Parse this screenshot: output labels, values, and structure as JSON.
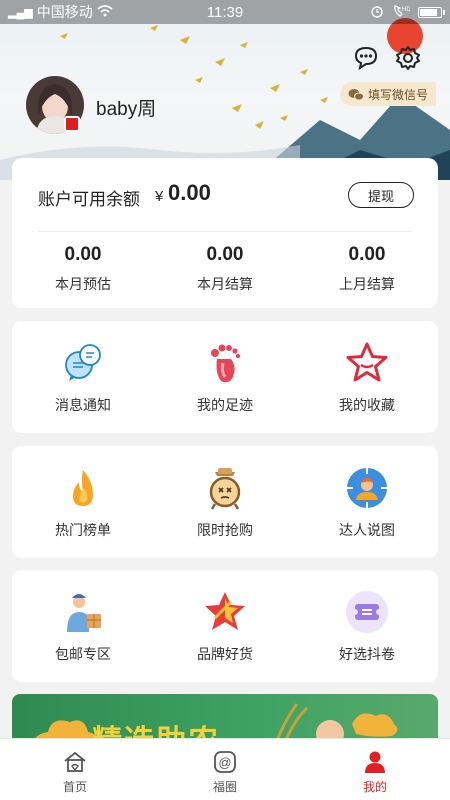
{
  "status_bar": {
    "carrier": "中国移动",
    "time": "11:39",
    "battery_level": 0.9
  },
  "profile": {
    "username": "baby周",
    "wechat_button": "填写微信号"
  },
  "balance": {
    "label": "账户可用余额",
    "currency": "¥",
    "amount": "0.00",
    "withdraw_button": "提现",
    "stats": [
      {
        "value": "0.00",
        "label": "本月预估"
      },
      {
        "value": "0.00",
        "label": "本月结算"
      },
      {
        "value": "0.00",
        "label": "上月结算"
      }
    ]
  },
  "menu_rows": [
    [
      {
        "label": "消息通知",
        "icon": "message-notification-icon"
      },
      {
        "label": "我的足迹",
        "icon": "footprint-icon"
      },
      {
        "label": "我的收藏",
        "icon": "star-icon"
      }
    ],
    [
      {
        "label": "热门榜单",
        "icon": "flame-icon"
      },
      {
        "label": "限时抢购",
        "icon": "alarm-clock-icon"
      },
      {
        "label": "达人说图",
        "icon": "influencer-icon"
      }
    ],
    [
      {
        "label": "包邮专区",
        "icon": "delivery-person-icon"
      },
      {
        "label": "品牌好货",
        "icon": "brand-star-icon"
      },
      {
        "label": "好选抖卷",
        "icon": "coupon-icon"
      }
    ]
  ],
  "banner": {
    "text": "精选助农"
  },
  "tabs": [
    {
      "label": "首页",
      "icon": "home-icon",
      "active": false
    },
    {
      "label": "福圈",
      "icon": "at-circle-icon",
      "active": false
    },
    {
      "label": "我的",
      "icon": "person-icon",
      "active": true
    }
  ],
  "colors": {
    "accent": "#e02020",
    "wechat_bg": "#f6e7cf",
    "banner_green": "#3fa363"
  }
}
